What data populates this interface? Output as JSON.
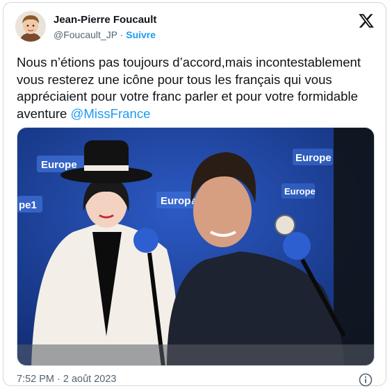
{
  "author": {
    "name": "Jean-Pierre Foucault",
    "handle": "@Foucault_JP",
    "separator": "·",
    "follow_label": "Suivre"
  },
  "tweet": {
    "text": "Nous n’étions pas toujours d’accord,mais incontestablement vous resterez une icône pour tous les français qui vous appréciaient pour votre franc parler et pour votre formidable aventure ",
    "mention": "@MissFrance"
  },
  "photo": {
    "logo_text": "Europe",
    "logo_num": "1",
    "partial_logo": "pe1"
  },
  "meta": {
    "timestamp": "7:52 PM · 2 août 2023"
  },
  "icons": [
    "x-logo-icon",
    "info-icon"
  ],
  "colors": {
    "link": "#1d9bf0",
    "text": "#0f1419",
    "secondary": "#536471",
    "studio_blue": "#1c3fa0"
  }
}
